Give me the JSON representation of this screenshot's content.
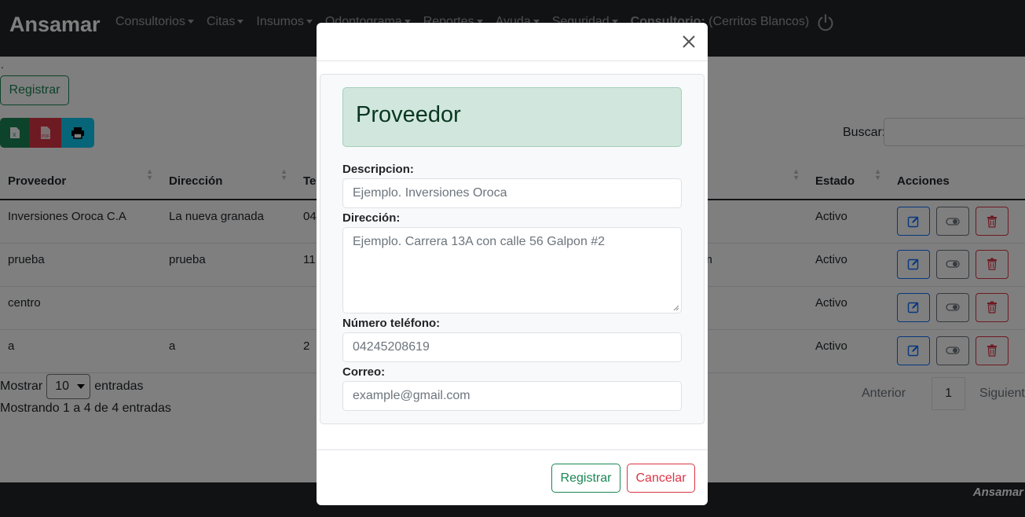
{
  "navbar": {
    "brand": "Ansamar",
    "items": [
      {
        "label": "Consultorios"
      },
      {
        "label": "Citas"
      },
      {
        "label": "Insumos"
      },
      {
        "label": "Odontograma"
      },
      {
        "label": "Reportes"
      },
      {
        "label": "Ayuda"
      },
      {
        "label": "Seguridad"
      }
    ],
    "current_bold": "Consultorio:",
    "current_name": " (Cerritos Blancos)",
    "power_icon": "power-icon"
  },
  "page": {
    "dot": ".",
    "register_label": "Registrar",
    "export_icons": [
      "excel-icon",
      "pdf-icon",
      "print-icon"
    ],
    "search_label": "Buscar:",
    "table": {
      "headers": [
        "Proveedor",
        "Dirección",
        "Te",
        "",
        "Estado",
        "Acciones"
      ],
      "rows": [
        {
          "proveedor": "Inversiones Oroca C.A",
          "direccion": "La nueva granada",
          "telefono": "04",
          "correo": "",
          "estado": "Activo"
        },
        {
          "proveedor": "prueba",
          "direccion": "prueba",
          "telefono": "11",
          "correo": "om",
          "estado": "Activo"
        },
        {
          "proveedor": "centro",
          "direccion": "",
          "telefono": "",
          "correo": "",
          "estado": "Activo"
        },
        {
          "proveedor": "a",
          "direccion": "a",
          "telefono": "2",
          "correo": "",
          "estado": "Activo"
        }
      ]
    },
    "show_prefix": "Mostrar",
    "show_value": "10",
    "show_suffix": "entradas",
    "info": "Mostrando 1 a 4 de 4 entradas",
    "pager": {
      "prev": "Anterior",
      "page": "1",
      "next": "Siguiente"
    },
    "footer_brand": "Ansamar"
  },
  "modal": {
    "title": "Proveedor",
    "fields": {
      "descripcion": {
        "label": "Descripcion:",
        "placeholder": "Ejemplo. Inversiones Oroca"
      },
      "direccion": {
        "label": "Dirección:",
        "placeholder": "Ejemplo. Carrera 13A con calle 56 Galpon #2"
      },
      "telefono": {
        "label": "Número teléfono:",
        "placeholder": "04245208619"
      },
      "correo": {
        "label": "Correo:",
        "placeholder": "example@gmail.com"
      }
    },
    "register_label": "Registrar",
    "cancel_label": "Cancelar"
  },
  "colors": {
    "success": "#198754",
    "danger": "#dc3545",
    "info": "#0dcaf0",
    "primary": "#0d6efd",
    "navbar": "#212529"
  }
}
